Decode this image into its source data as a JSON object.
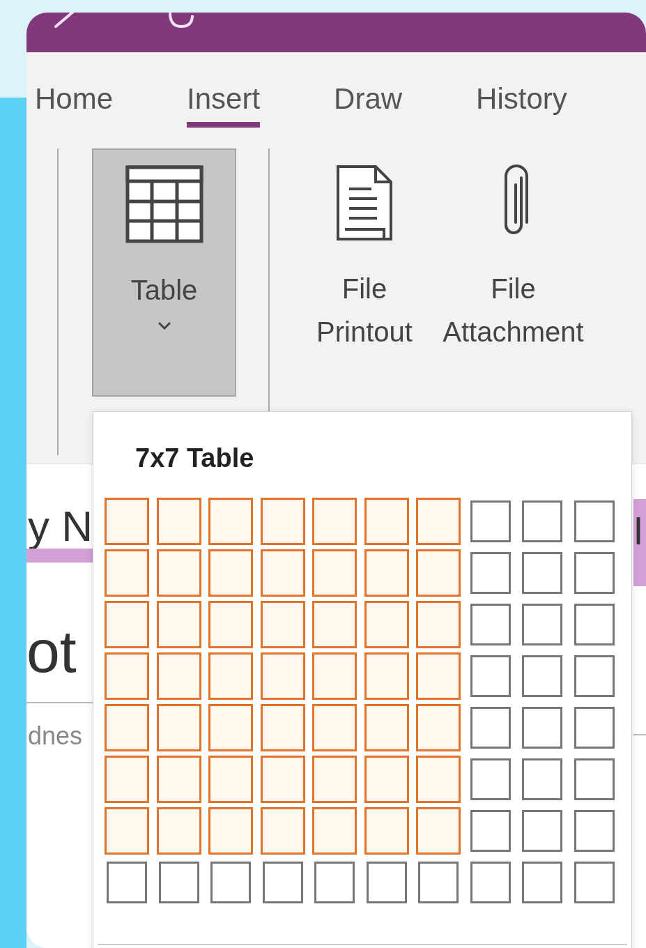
{
  "tabs": [
    {
      "label": "Home",
      "selected": false
    },
    {
      "label": "Insert",
      "selected": true
    },
    {
      "label": "Draw",
      "selected": false
    },
    {
      "label": "History",
      "selected": false
    }
  ],
  "ribbon": {
    "buttons": [
      {
        "kind": "table",
        "label": "Table",
        "pressed": true,
        "dropdown": true
      },
      {
        "kind": "printout",
        "lines": [
          "File",
          "Printout"
        ],
        "pressed": false
      },
      {
        "kind": "attachment",
        "lines": [
          "File",
          "Attachment"
        ],
        "pressed": false
      }
    ]
  },
  "page": {
    "section_text": "y N",
    "section_text_right": "l",
    "title": "ot",
    "date": "dnes"
  },
  "table_picker": {
    "label": "7x7 Table",
    "rows": [
      {
        "cells": [
          {
            "selected": true
          },
          {
            "selected": true
          },
          {
            "selected": true
          },
          {
            "selected": true
          },
          {
            "selected": true
          },
          {
            "selected": true
          },
          {
            "selected": true
          },
          {
            "selected": false
          },
          {
            "selected": false
          },
          {
            "selected": false
          }
        ]
      },
      {
        "cells": [
          {
            "selected": true
          },
          {
            "selected": true
          },
          {
            "selected": true
          },
          {
            "selected": true
          },
          {
            "selected": true
          },
          {
            "selected": true
          },
          {
            "selected": true
          },
          {
            "selected": false
          },
          {
            "selected": false
          },
          {
            "selected": false
          }
        ]
      },
      {
        "cells": [
          {
            "selected": true
          },
          {
            "selected": true
          },
          {
            "selected": true
          },
          {
            "selected": true
          },
          {
            "selected": true
          },
          {
            "selected": true
          },
          {
            "selected": true
          },
          {
            "selected": false
          },
          {
            "selected": false
          },
          {
            "selected": false
          }
        ]
      },
      {
        "cells": [
          {
            "selected": true
          },
          {
            "selected": true
          },
          {
            "selected": true
          },
          {
            "selected": true
          },
          {
            "selected": true
          },
          {
            "selected": true
          },
          {
            "selected": true
          },
          {
            "selected": false
          },
          {
            "selected": false
          },
          {
            "selected": false
          }
        ]
      },
      {
        "cells": [
          {
            "selected": true
          },
          {
            "selected": true
          },
          {
            "selected": true
          },
          {
            "selected": true
          },
          {
            "selected": true
          },
          {
            "selected": true
          },
          {
            "selected": true
          },
          {
            "selected": false
          },
          {
            "selected": false
          },
          {
            "selected": false
          }
        ]
      },
      {
        "cells": [
          {
            "selected": true
          },
          {
            "selected": true
          },
          {
            "selected": true
          },
          {
            "selected": true
          },
          {
            "selected": true
          },
          {
            "selected": true
          },
          {
            "selected": true
          },
          {
            "selected": false
          },
          {
            "selected": false
          },
          {
            "selected": false
          }
        ]
      },
      {
        "cells": [
          {
            "selected": true
          },
          {
            "selected": true
          },
          {
            "selected": true
          },
          {
            "selected": true
          },
          {
            "selected": true
          },
          {
            "selected": true
          },
          {
            "selected": true
          },
          {
            "selected": false
          },
          {
            "selected": false
          },
          {
            "selected": false
          }
        ]
      },
      {
        "cells": [
          {
            "selected": false
          },
          {
            "selected": false
          },
          {
            "selected": false
          },
          {
            "selected": false
          },
          {
            "selected": false
          },
          {
            "selected": false
          },
          {
            "selected": false
          },
          {
            "selected": false
          },
          {
            "selected": false
          },
          {
            "selected": false
          }
        ]
      }
    ]
  }
}
